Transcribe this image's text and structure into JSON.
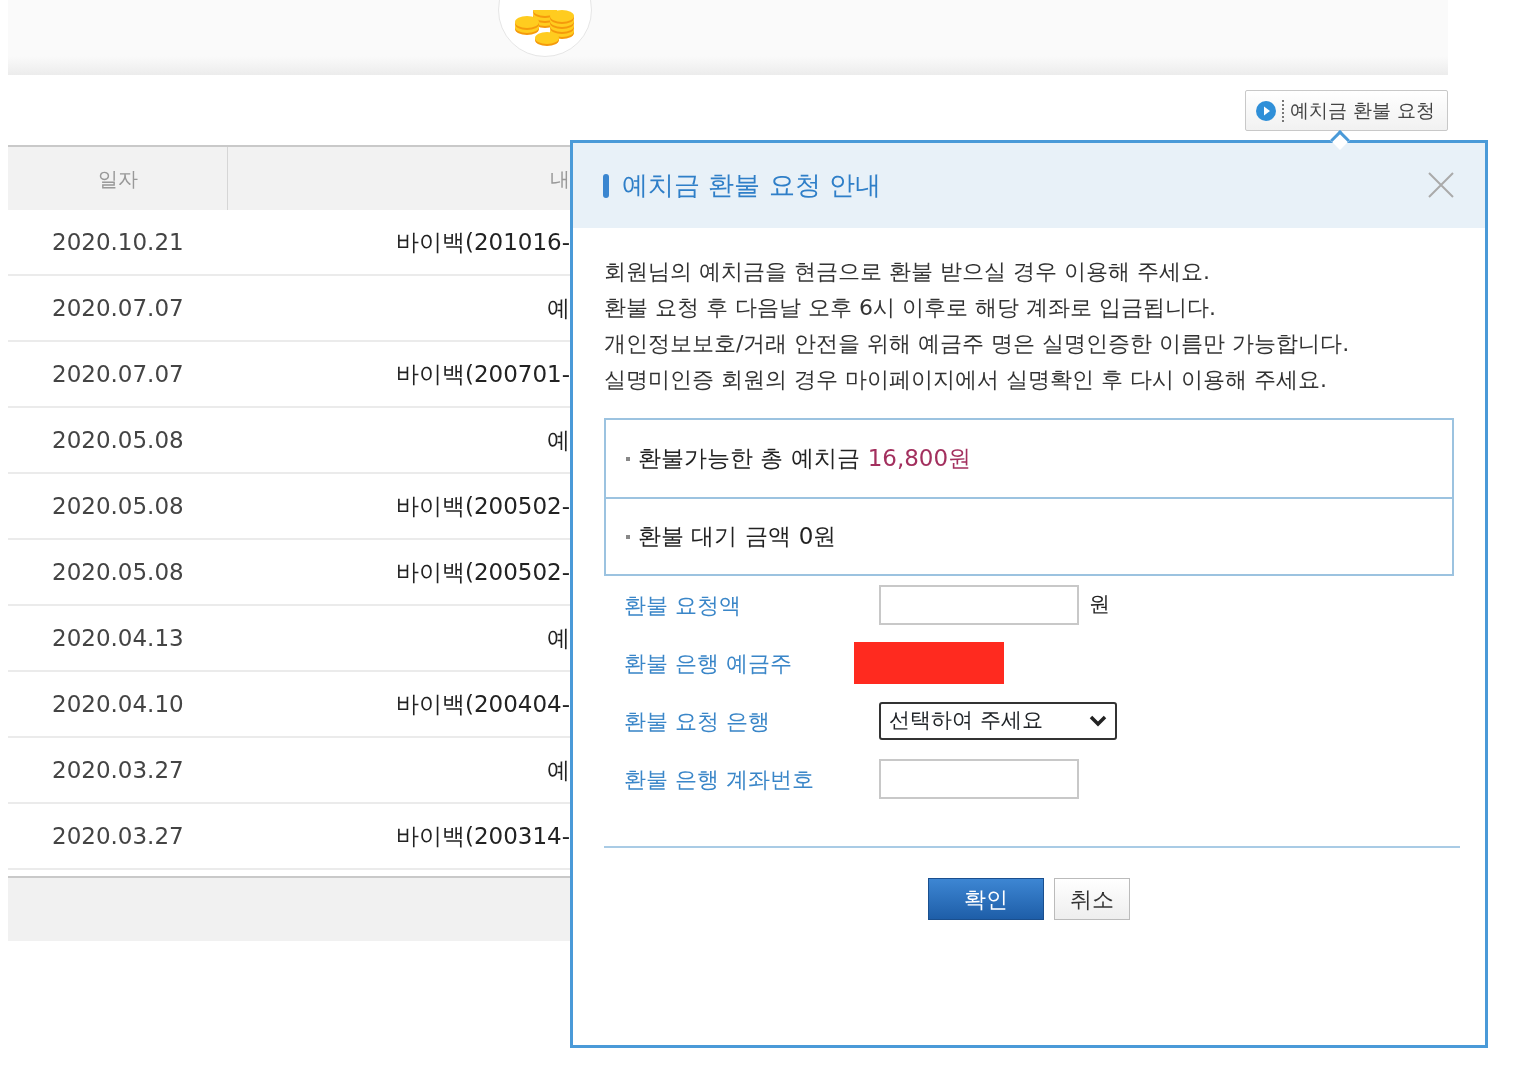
{
  "banner": {
    "kind": "coins"
  },
  "refund_request_button": {
    "label": "예치금 환불 요청"
  },
  "table": {
    "columns": [
      "일자",
      "내"
    ],
    "rows": [
      {
        "date": "2020.10.21",
        "content": "바이백(201016-"
      },
      {
        "date": "2020.07.07",
        "content": "예"
      },
      {
        "date": "2020.07.07",
        "content": "바이백(200701-"
      },
      {
        "date": "2020.05.08",
        "content": "예"
      },
      {
        "date": "2020.05.08",
        "content": "바이백(200502-"
      },
      {
        "date": "2020.05.08",
        "content": "바이백(200502-"
      },
      {
        "date": "2020.04.13",
        "content": "예"
      },
      {
        "date": "2020.04.10",
        "content": "바이백(200404-"
      },
      {
        "date": "2020.03.27",
        "content": "예"
      },
      {
        "date": "2020.03.27",
        "content": "바이백(200314-"
      }
    ]
  },
  "dialog": {
    "title": "예치금 환불 요청 안내",
    "notice": [
      "회원님의 예치금을 현금으로 환불 받으실 경우 이용해 주세요.",
      "환불 요청 후 다음날 오후 6시 이후로 해당 계좌로 입금됩니다.",
      "개인정보보호/거래 안전을 위해 예금주 명은 실명인증한 이름만 가능합니다.",
      "실명미인증 회원의 경우 마이페이지에서 실명확인 후 다시 이용해 주세요."
    ],
    "summary": [
      {
        "label": "환불가능한 총 예치금",
        "amount": "16,800원",
        "highlight": true
      },
      {
        "label": "환불 대기 금액",
        "amount": "0원",
        "highlight": false
      }
    ],
    "form": [
      {
        "kind": "input",
        "label": "환불 요청액",
        "unit": "원"
      },
      {
        "kind": "redacted",
        "label": "환불 은행 예금주"
      },
      {
        "kind": "select",
        "label": "환불 요청 은행",
        "value": "선택하여 주세요"
      },
      {
        "kind": "input",
        "label": "환불 은행 계좌번호"
      }
    ],
    "buttons": [
      {
        "label": "확인",
        "primary": true
      },
      {
        "label": "취소",
        "primary": false
      }
    ]
  }
}
